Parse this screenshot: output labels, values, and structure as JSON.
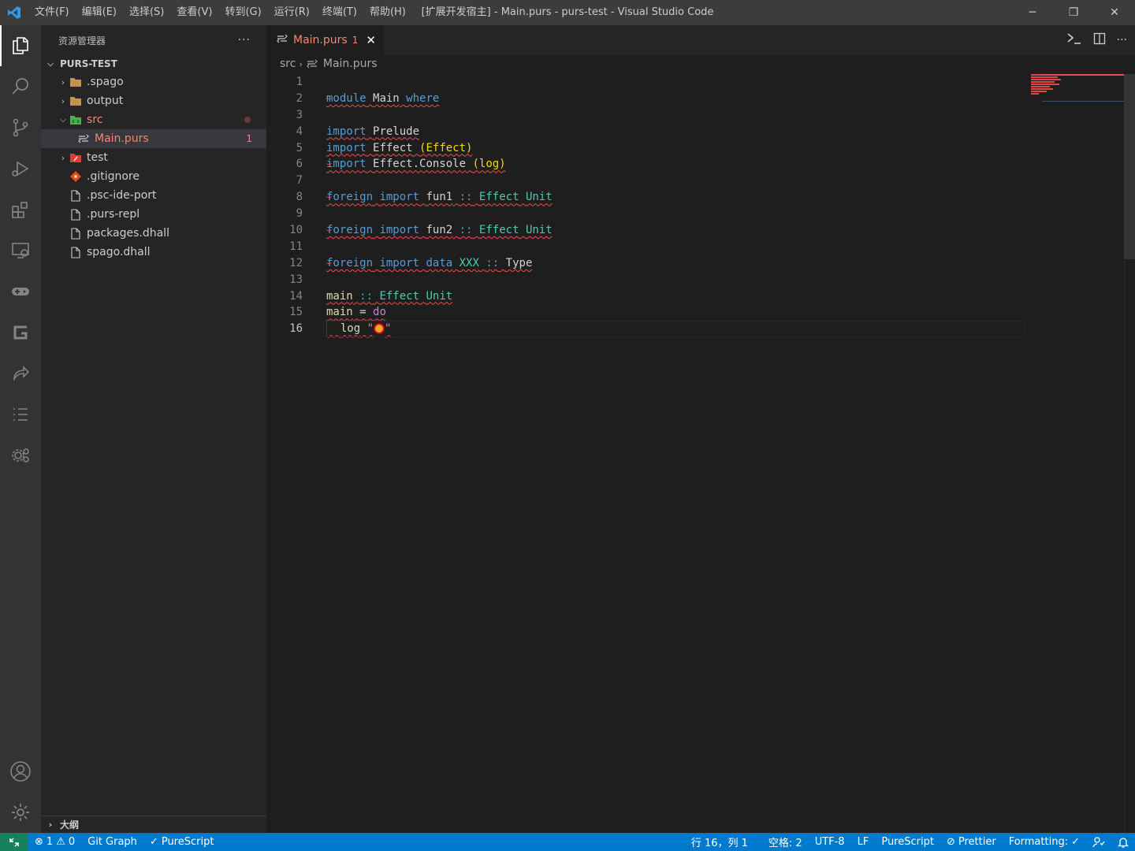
{
  "titlebar": {
    "menu": [
      "文件(F)",
      "编辑(E)",
      "选择(S)",
      "查看(V)",
      "转到(G)",
      "运行(R)",
      "终端(T)",
      "帮助(H)"
    ],
    "title": "[扩展开发宿主] - Main.purs - purs-test - Visual Studio Code",
    "controls": {
      "minimize": "─",
      "restore": "❐",
      "close": "✕"
    }
  },
  "activitybar": {
    "icons": [
      "explorer-icon",
      "search-icon",
      "source-control-icon",
      "run-debug-icon",
      "extensions-icon",
      "remote-explorer-icon",
      "gamepad-icon",
      "gitlens-icon",
      "live-share-icon",
      "list-icon",
      "settings-sync-icon"
    ],
    "bottom_icons": [
      "account-icon",
      "manage-gear-icon"
    ]
  },
  "sidebar": {
    "title": "资源管理器",
    "more": "···",
    "section_title": "PURS-TEST",
    "tree": [
      {
        "label": ".spago",
        "type": "folder",
        "expanded": false,
        "level": 1
      },
      {
        "label": "output",
        "type": "folder",
        "expanded": false,
        "level": 1
      },
      {
        "label": "src",
        "type": "folder-src",
        "expanded": true,
        "level": 1,
        "error": true
      },
      {
        "label": "Main.purs",
        "type": "purs",
        "level": 2,
        "error": true,
        "badge": "1",
        "selected": true
      },
      {
        "label": "test",
        "type": "folder-test",
        "expanded": false,
        "level": 1
      },
      {
        "label": ".gitignore",
        "type": "git",
        "level": 1
      },
      {
        "label": ".psc-ide-port",
        "type": "file",
        "level": 1
      },
      {
        "label": ".purs-repl",
        "type": "file",
        "level": 1
      },
      {
        "label": "packages.dhall",
        "type": "file",
        "level": 1
      },
      {
        "label": "spago.dhall",
        "type": "file",
        "level": 1
      }
    ],
    "outline_title": "大纲"
  },
  "editor": {
    "tab": {
      "label": "Main.purs",
      "count": "1",
      "close": "✕"
    },
    "breadcrumb": {
      "folder": "src",
      "file": "Main.purs"
    },
    "current_line": 16,
    "lines": [
      {
        "n": "1"
      },
      {
        "n": "2"
      },
      {
        "n": "3"
      },
      {
        "n": "4"
      },
      {
        "n": "5"
      },
      {
        "n": "6"
      },
      {
        "n": "7"
      },
      {
        "n": "8"
      },
      {
        "n": "9"
      },
      {
        "n": "10"
      },
      {
        "n": "11"
      },
      {
        "n": "12"
      },
      {
        "n": "13"
      },
      {
        "n": "14"
      },
      {
        "n": "15"
      },
      {
        "n": "16"
      }
    ],
    "code": {
      "l1": [
        "module",
        "Main",
        "where"
      ],
      "l3": [
        "import",
        "Prelude"
      ],
      "l4": [
        "import",
        "Effect",
        "(Effect)"
      ],
      "l5": [
        "import",
        "Effect.Console",
        "(log)"
      ],
      "l7": [
        "foreign",
        "import",
        "fun1",
        "::",
        "Effect",
        "Unit"
      ],
      "l9": [
        "foreign",
        "import",
        "fun2",
        "::",
        "Effect",
        "Unit"
      ],
      "l11": [
        "foreign",
        "import",
        "data",
        "XXX",
        "::",
        "Type"
      ],
      "l13": [
        "main",
        "::",
        "Effect",
        "Unit"
      ],
      "l14": [
        "main",
        "=",
        "do"
      ],
      "l15": [
        "log",
        "\""
      ]
    }
  },
  "statusbar": {
    "errors": "1",
    "warnings": "0",
    "git_graph": "Git Graph",
    "purescript_check": "PureScript",
    "position": "行 16，列 1",
    "spaces": "空格: 2",
    "encoding": "UTF-8",
    "eol": "LF",
    "language": "PureScript",
    "prettier": "Prettier",
    "formatting": "Formatting:"
  },
  "colors": {
    "accent": "#007acc",
    "error": "#f48771",
    "squiggle": "#f14c4c",
    "remote": "#16825d"
  }
}
